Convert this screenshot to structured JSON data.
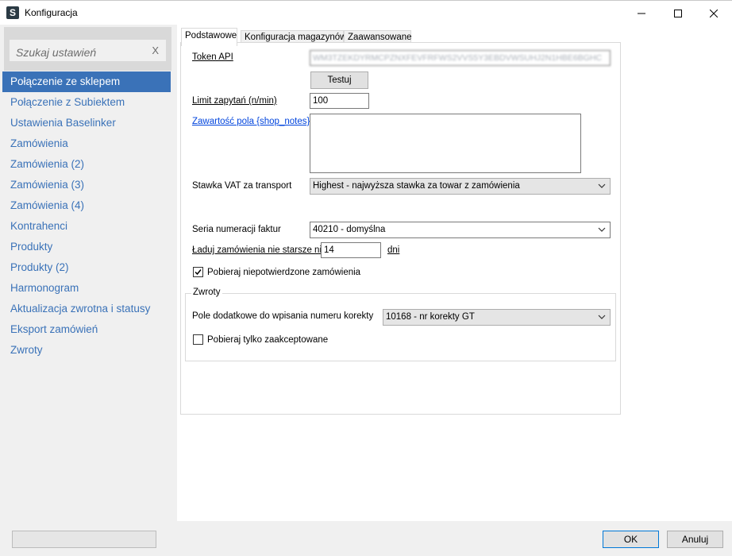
{
  "window": {
    "title": "Konfiguracja",
    "icon_letter": "S"
  },
  "sidebar": {
    "search_placeholder": "Szukaj ustawień",
    "search_clear": "X",
    "items": [
      {
        "label": "Połączenie ze sklepem",
        "active": true
      },
      {
        "label": "Połączenie z Subiektem"
      },
      {
        "label": "Ustawienia Baselinker"
      },
      {
        "label": "Zamówienia"
      },
      {
        "label": "Zamówienia (2)"
      },
      {
        "label": "Zamówienia (3)"
      },
      {
        "label": "Zamówienia (4)"
      },
      {
        "label": "Kontrahenci"
      },
      {
        "label": "Produkty"
      },
      {
        "label": "Produkty (2)"
      },
      {
        "label": "Harmonogram"
      },
      {
        "label": "Aktualizacja zwrotna i statusy"
      },
      {
        "label": "Eksport zamówień"
      },
      {
        "label": "Zwroty"
      }
    ]
  },
  "tabs": [
    {
      "label": "Podstawowe",
      "active": true
    },
    {
      "label": "Konfiguracja magazynów"
    },
    {
      "label": "Zaawansowane"
    }
  ],
  "form": {
    "token_label": "Token API",
    "token_value": "WM3TZEKDYRMCPZNXFEVFRFWS2VVS5Y3EBDVWSUHJ2N1HBE6BGHC",
    "test_button": "Testuj",
    "limit_label": "Limit zapytań (n/min)",
    "limit_value": "100",
    "notes_label": "Zawartość pola {shop_notes}",
    "notes_value": "",
    "vat_label": "Stawka VAT za transport",
    "vat_value": "Highest - najwyższa stawka za towar z zamówienia",
    "series_label": "Seria numeracji faktur",
    "series_value": "40210 - domyślna",
    "load_label": "Ładuj zamówienia nie starsze niż",
    "load_value": "14",
    "load_unit": "dni",
    "unconfirmed_label": "Pobieraj niepotwierdzone zamówienia",
    "unconfirmed_checked": true
  },
  "returns": {
    "group_title": "Zwroty",
    "field_label": "Pole dodatkowe do wpisania numeru korekty",
    "field_value": "10168 - nr korekty GT",
    "accepted_label": "Pobieraj tylko zaakceptowane",
    "accepted_checked": false
  },
  "footer": {
    "ok_label": "OK",
    "cancel_label": "Anuluj"
  },
  "colors": {
    "accent": "#3a72b8",
    "link": "#0044dd"
  }
}
